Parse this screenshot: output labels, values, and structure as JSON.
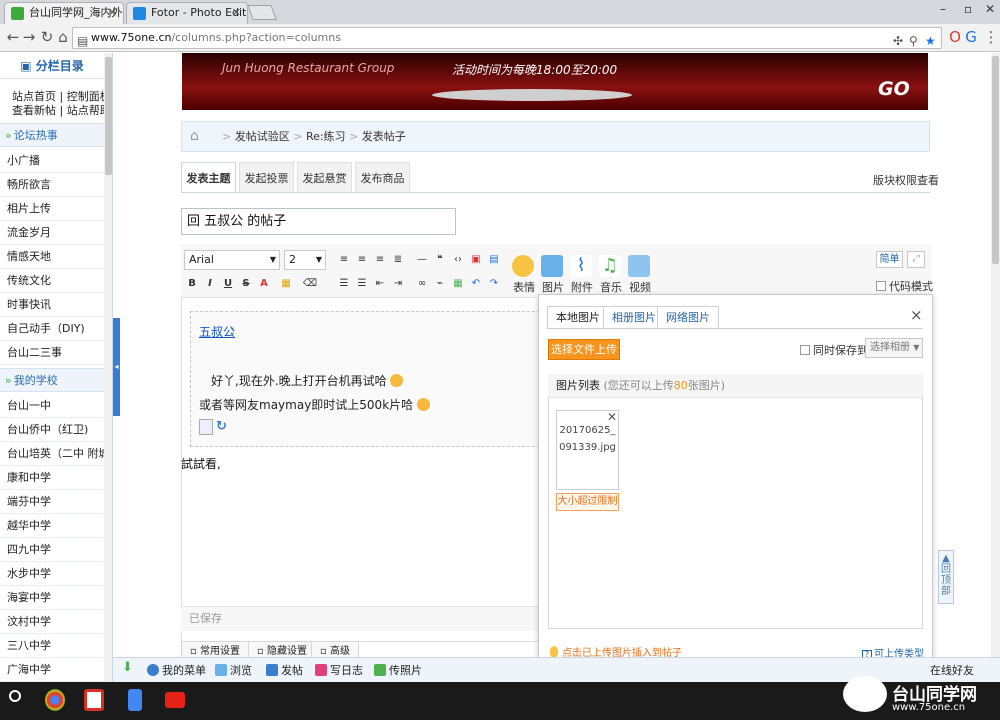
{
  "browser": {
    "tabs": [
      {
        "title": "台山同学网_海内外台山人"
      },
      {
        "title": "Fotor - Photo Editing & C"
      }
    ],
    "url_host": "www.75one.cn",
    "url_path": "/columns.php?action=columns",
    "window_controls": [
      "–",
      "▫",
      "✕"
    ]
  },
  "sidebar": {
    "title": "分栏目录",
    "quick_links": [
      "站点首页 | 控制面板",
      "查看新帖 | 站点帮助"
    ],
    "sections": [
      {
        "title": "论坛热事",
        "items": [
          "小广播",
          "畅所欲言",
          "相片上传",
          "流金岁月",
          "情感天地",
          "传统文化",
          "时事快讯",
          "自己动手（DIY)",
          "台山二三事"
        ]
      },
      {
        "title": "我的学校",
        "items": [
          "台山一中",
          "台山侨中（红卫)",
          "台山培英（二中 附城)",
          "康和中学",
          "端芬中学",
          "越华中学",
          "四九中学",
          "水步中学",
          "海宴中学",
          "汶村中学",
          "三八中学",
          "广海中学"
        ]
      }
    ]
  },
  "banner": {
    "brand_en": "Jun Huong Restaurant Group",
    "time_text": "活动时间为每晚18:00至20:00",
    "go": "GO"
  },
  "breadcrumb": {
    "items": [
      "发帖试验区",
      "Re:练习",
      "发表帖子"
    ]
  },
  "post_tabs": [
    "发表主题",
    "发起投票",
    "发起悬赏",
    "发布商品"
  ],
  "permission_link": "版块权限查看",
  "title_input": {
    "value": "回 五叔公 的帖子"
  },
  "editor": {
    "font_name": "Arial",
    "font_size": "2",
    "big_tools": [
      "表情",
      "图片",
      "附件",
      "音乐",
      "视频"
    ],
    "simple_btn": "简单",
    "code_mode": "代码模式",
    "quote_author": "五叔公",
    "quote_colon": ":",
    "quote_line1": "好丫,现在外.晚上打开台机再试哈",
    "quote_line2": "或者等网友maymay即时试上500k片哈",
    "typed_text": "試試看,",
    "saved": "已保存",
    "bottom_tabs": [
      "常用设置",
      "隐藏设置",
      "高级"
    ]
  },
  "upload_popup": {
    "tabs": [
      "本地图片",
      "相册图片",
      "网络图片"
    ],
    "close": "×",
    "choose_button": "选择文件上传",
    "save_same": "同时保存到",
    "album_select": "选择相册",
    "list_title": "图片列表",
    "list_sub_prefix": "(您还可以上传",
    "list_sub_num": "80",
    "list_sub_suffix": "张图片)",
    "file_name": "20170625_091339.jpg",
    "error": "大小超过限制",
    "hint": "点击已上传图片插入到帖子",
    "allowed_types": "可上传类型"
  },
  "back_to_top": "回顶部",
  "bottom_bar": {
    "items": [
      "我的菜单",
      "浏览",
      "发帖",
      "写日志",
      "传照片"
    ],
    "online": "在线好友"
  },
  "watermark": {
    "title": "台山同学网",
    "url": "www.75one.cn"
  },
  "colors": {
    "accent_blue": "#2266aa",
    "orange": "#f7941d",
    "sidebar_section_bg": "#eef4fa"
  }
}
